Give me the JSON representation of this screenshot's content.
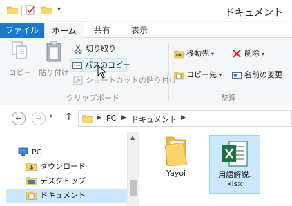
{
  "window": {
    "title": "ドキュメント",
    "quick_access_overflow": "▾"
  },
  "tabs": {
    "file": "ファイル",
    "home": "ホーム",
    "share": "共有",
    "view": "表示"
  },
  "ribbon": {
    "clipboard": {
      "copy": "コピー",
      "paste": "貼り付け",
      "cut": "切り取り",
      "copy_path": "パスのコピー",
      "paste_shortcut": "ショートカットの貼り付け",
      "group_label": "クリップボード"
    },
    "organize": {
      "move_to": "移動先",
      "copy_to": "コピー先",
      "delete": "削除",
      "rename": "名前の変更",
      "group_label": "整理"
    }
  },
  "address": {
    "crumbs": [
      "PC",
      "ドキュメント"
    ]
  },
  "tree": {
    "items": [
      {
        "label": "PC",
        "icon": "pc-icon"
      },
      {
        "label": "ダウンロード",
        "icon": "downloads-folder-icon"
      },
      {
        "label": "デスクトップ",
        "icon": "desktop-folder-icon"
      },
      {
        "label": "ドキュメント",
        "icon": "documents-folder-icon"
      }
    ]
  },
  "files": [
    {
      "name": "Yayoi",
      "type": "folder"
    },
    {
      "name": "用語解説.xlsx",
      "type": "excel"
    }
  ],
  "colors": {
    "accent": "#1979ca",
    "selection": "#cce8ff",
    "excel_green": "#1d7044",
    "folder_yellow": "#f3cd5f"
  }
}
